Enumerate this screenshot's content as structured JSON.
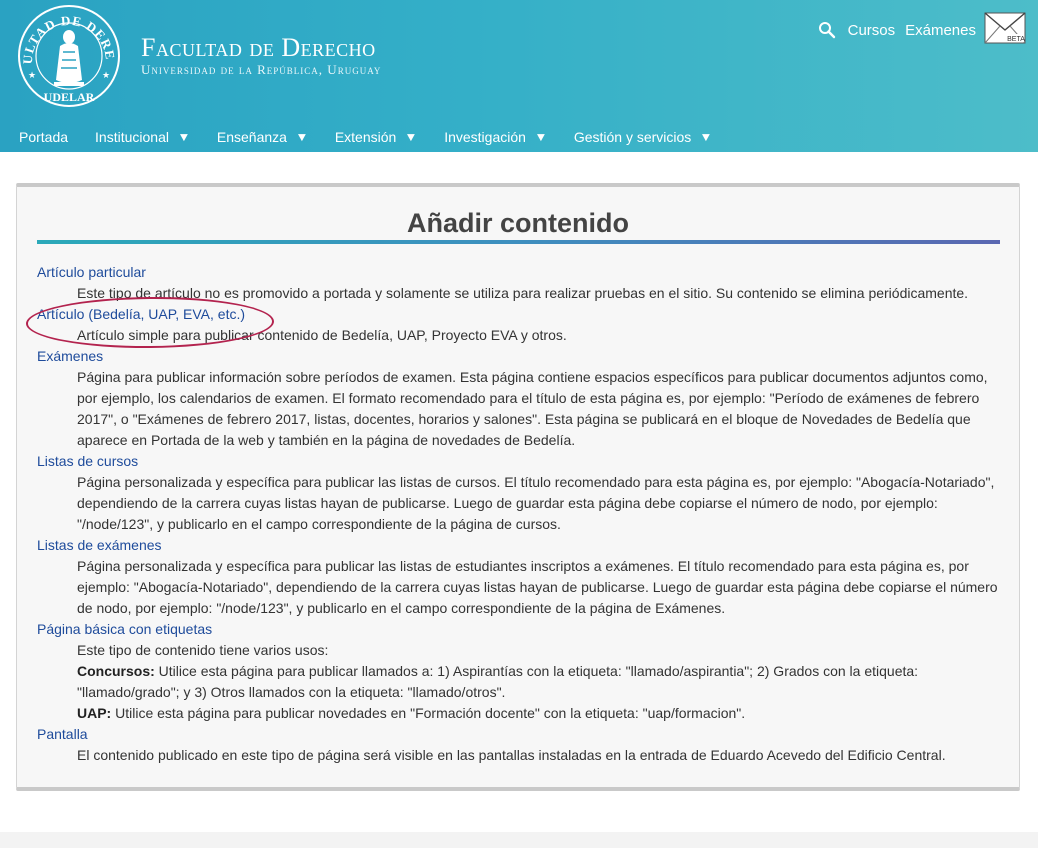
{
  "site": {
    "title": "Facultad de Derecho",
    "subtitle": "Universidad de la República, Uruguay",
    "seal_text_top": "FACULTAD DE DERECHO",
    "seal_text_bottom": "UDELAR"
  },
  "top_links": {
    "cursos": "Cursos",
    "examenes": "Exámenes",
    "mail_badge": "BETA"
  },
  "nav": [
    {
      "label": "Portada",
      "has_submenu": false
    },
    {
      "label": "Institucional",
      "has_submenu": true
    },
    {
      "label": "Enseñanza",
      "has_submenu": true
    },
    {
      "label": "Extensión",
      "has_submenu": true
    },
    {
      "label": "Investigación",
      "has_submenu": true
    },
    {
      "label": "Gestión y servicios",
      "has_submenu": true
    }
  ],
  "nav_caret": "▼",
  "page": {
    "title": "Añadir contenido"
  },
  "content_types": [
    {
      "name": "Artículo particular",
      "description": [
        "Este tipo de artículo no es promovido a portada y solamente se utiliza para realizar pruebas en el sitio. Su contenido se elimina periódicamente."
      ]
    },
    {
      "name": "Artículo (Bedelía, UAP, EVA, etc.)",
      "description": [
        "Artículo simple para publicar contenido de Bedelía, UAP, Proyecto EVA y otros."
      ]
    },
    {
      "name": "Exámenes",
      "description": [
        "Página para publicar información sobre períodos de examen. Esta página contiene espacios específicos para publicar documentos adjuntos como, por ejemplo, los calendarios de examen. El formato recomendado para el título de esta página es, por ejemplo: \"Período de exámenes de febrero 2017\", o \"Exámenes de febrero 2017, listas, docentes, horarios y salones\". Esta página se publicará en el bloque de Novedades de Bedelía que aparece en Portada de la web y también en la página de novedades de Bedelía."
      ]
    },
    {
      "name": "Listas de cursos",
      "description": [
        "Página personalizada y específica para publicar las listas de cursos. El título recomendado para esta página es, por ejemplo: \"Abogacía-Notariado\", dependiendo de la carrera cuyas listas hayan de publicarse. Luego de guardar esta página debe copiarse el número de nodo, por ejemplo: \"/node/123\", y publicarlo en el campo correspondiente de la página de cursos."
      ]
    },
    {
      "name": "Listas de exámenes",
      "description": [
        "Página personalizada y específica para publicar las listas de estudiantes inscriptos a exámenes. El título recomendado para esta página es, por ejemplo: \"Abogacía-Notariado\", dependiendo de la carrera cuyas listas hayan de publicarse. Luego de guardar esta página debe copiarse el número de nodo, por ejemplo: \"/node/123\", y publicarlo en el campo correspondiente de la página de Exámenes."
      ]
    },
    {
      "name": "Página básica con etiquetas",
      "description_intro": "Este tipo de contenido tiene varios usos:",
      "description_parts": [
        {
          "bold": "Concursos:",
          "text": " Utilice esta página para publicar llamados a: 1) Aspirantías con la etiqueta: \"llamado/aspirantia\"; 2) Grados con la etiqueta: \"llamado/grado\"; y 3) Otros llamados con la etiqueta: \"llamado/otros\"."
        },
        {
          "bold": "UAP:",
          "text": " Utilice esta página para publicar novedades en \"Formación docente\" con la etiqueta: \"uap/formacion\"."
        }
      ]
    },
    {
      "name": "Pantalla",
      "description": [
        "El contenido publicado en este tipo de página será visible en las pantallas instaladas en la entrada de Eduardo Acevedo del Edificio Central."
      ]
    }
  ],
  "colors": {
    "header_gradient_start": "#2aa2c2",
    "header_gradient_end": "#4dbdc9",
    "link": "#1e4b9b",
    "highlight_ring": "#b3234e"
  }
}
